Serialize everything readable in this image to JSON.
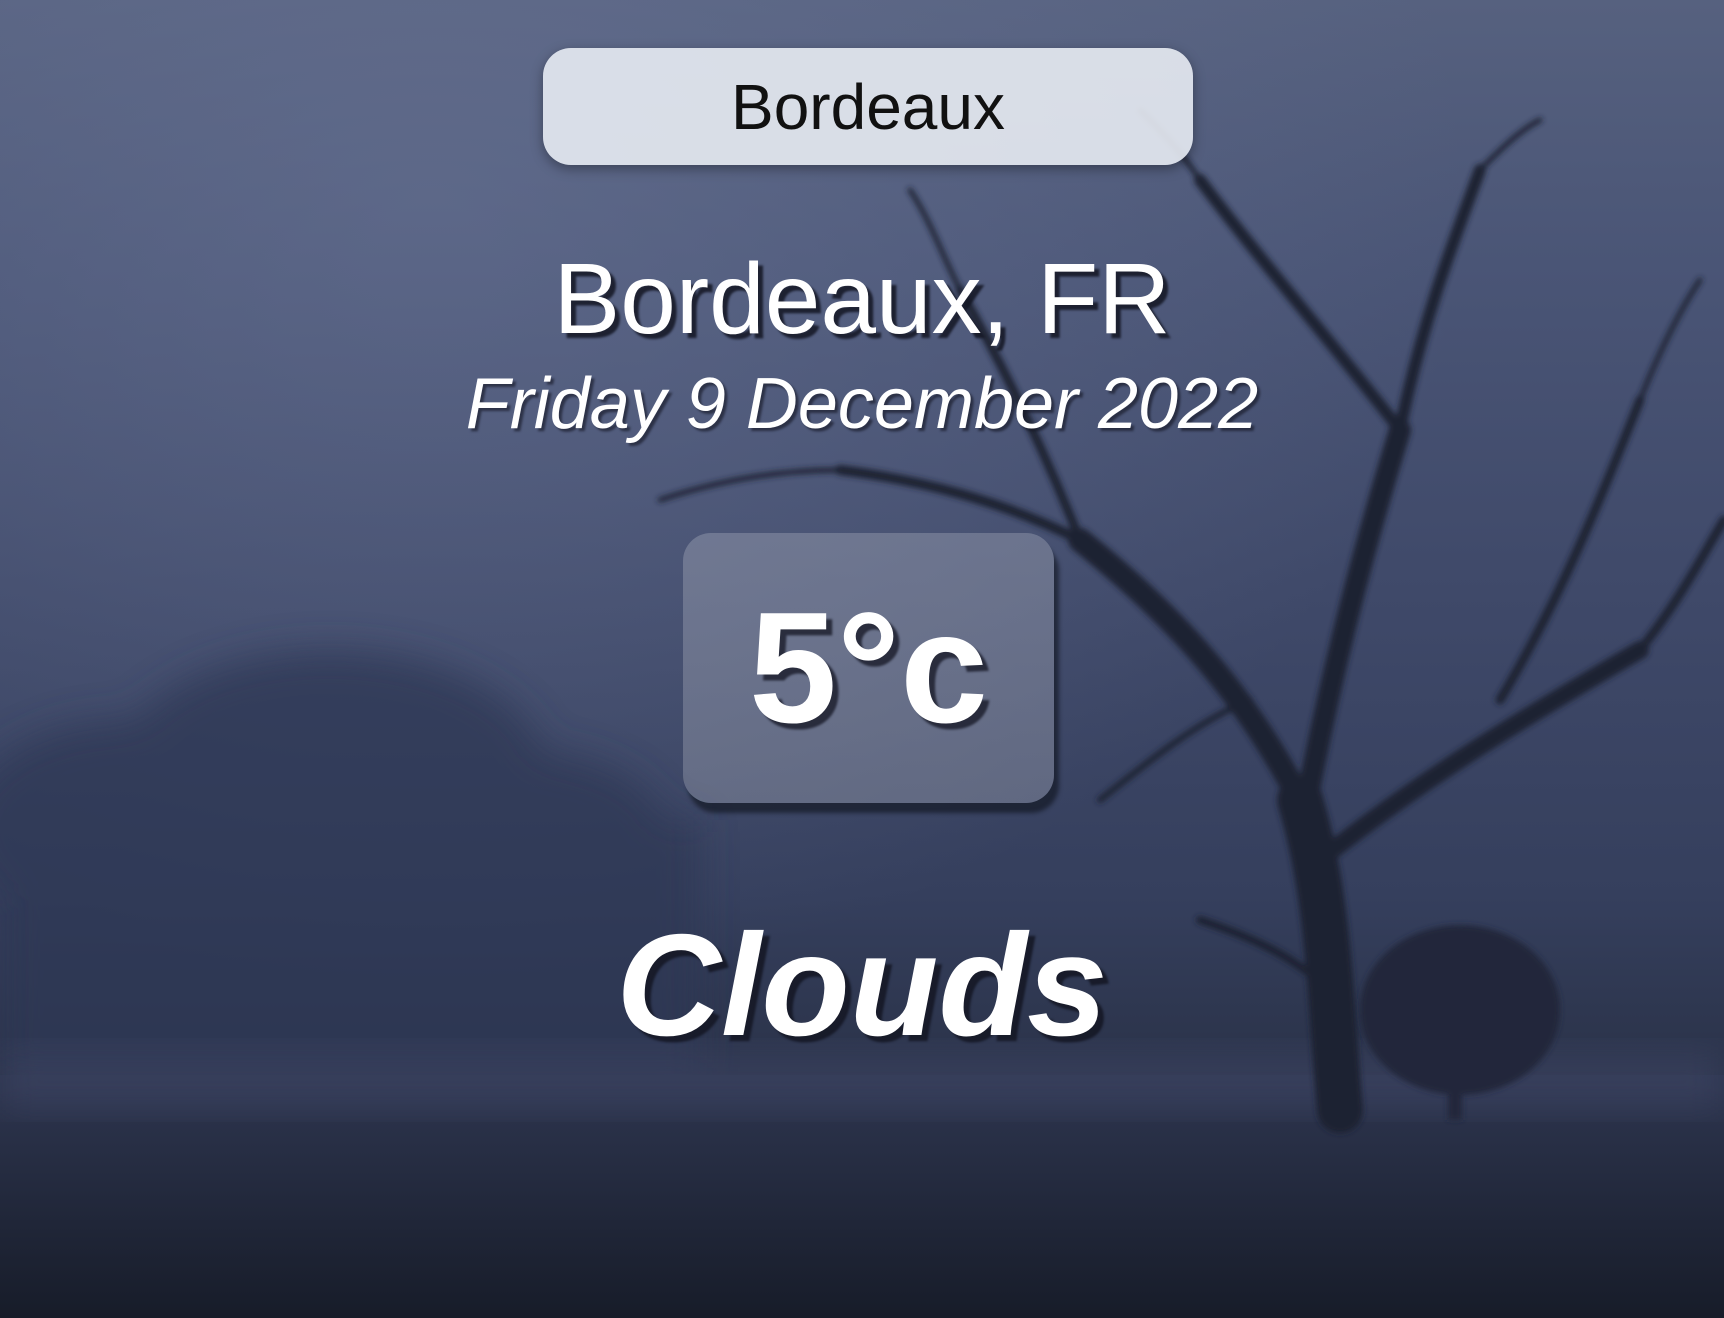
{
  "search": {
    "value": "Bordeaux"
  },
  "location": {
    "place": "Bordeaux, FR",
    "date": "Friday 9 December 2022"
  },
  "weather": {
    "temperature": "5°c",
    "condition": "Clouds"
  },
  "background": {
    "scene": "foggy-night-tree-image"
  }
}
